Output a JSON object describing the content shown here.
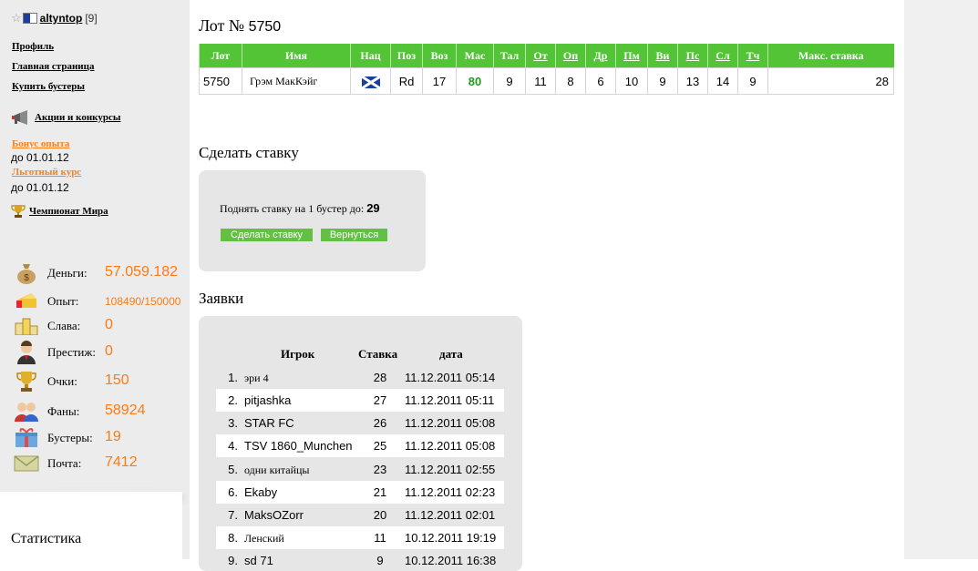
{
  "user": {
    "name": "altyntop",
    "level": "[9]"
  },
  "nav": {
    "profile": "Профиль",
    "home": "Главная страница",
    "buy_boosters": "Купить бустеры",
    "promos": "Акции и конкурсы",
    "bonus_label": "Бонус опыта",
    "bonus_until": "до 01.01.12",
    "course_label": "Льготный курс",
    "course_until": "до 01.01.12",
    "world_cup": "Чемпионат Мира"
  },
  "stats": [
    {
      "label": "Деньги:",
      "value": "57.059.182",
      "icon": "money-bag-icon"
    },
    {
      "label": "Опыт:",
      "value": "108490/150000",
      "icon": "cheese-icon"
    },
    {
      "label": "Слава:",
      "value": "0",
      "icon": "podium-icon"
    },
    {
      "label": "Престиж:",
      "value": "0",
      "icon": "person-icon"
    },
    {
      "label": "Очки:",
      "value": "150",
      "icon": "trophy-icon"
    },
    {
      "label": "Фаны:",
      "value": "58924",
      "icon": "fans-icon"
    },
    {
      "label": "Бустеры:",
      "value": "19",
      "icon": "gift-icon"
    },
    {
      "label": "Почта:",
      "value": "7412",
      "icon": "envelope-icon"
    }
  ],
  "stats_title": "Статистика",
  "lot": {
    "title_prefix": "Лот №",
    "number": "5750",
    "headers": [
      "Лот",
      "Имя",
      "Нац",
      "Поз",
      "Воз",
      "Мас",
      "Тал",
      "От",
      "Оп",
      "Др",
      "Пм",
      "Ви",
      "Пс",
      "Сл",
      "Тч",
      "Макс. ставка"
    ],
    "row": {
      "lot": "5750",
      "name": "Грэм МакКэйг",
      "nation": "Scotland",
      "pos": "Rd",
      "age": "17",
      "mas": "80",
      "tal": "9",
      "ot": "11",
      "op": "8",
      "dr": "6",
      "pm": "10",
      "vi": "9",
      "ps": "13",
      "sl": "14",
      "tch": "9",
      "max_bid": "28"
    }
  },
  "bid": {
    "title": "Сделать ставку",
    "text": "Поднять ставку на 1 бустер до:",
    "amount": "29",
    "submit": "Сделать ставку",
    "back": "Вернуться"
  },
  "requests": {
    "title": "Заявки",
    "headers": {
      "player": "Игрок",
      "bid": "Ставка",
      "date": "дата"
    },
    "rows": [
      {
        "n": "1.",
        "player": "эри 4",
        "bid": "28",
        "date": "11.12.2011 05:14"
      },
      {
        "n": "2.",
        "player": "pitjashka",
        "bid": "27",
        "date": "11.12.2011 05:11"
      },
      {
        "n": "3.",
        "player": "STAR FC",
        "bid": "26",
        "date": "11.12.2011 05:08"
      },
      {
        "n": "4.",
        "player": "TSV 1860_Munchen",
        "bid": "25",
        "date": "11.12.2011 05:08"
      },
      {
        "n": "5.",
        "player": "одни китайцы",
        "bid": "23",
        "date": "11.12.2011 02:55"
      },
      {
        "n": "6.",
        "player": "Ekaby",
        "bid": "21",
        "date": "11.12.2011 02:23"
      },
      {
        "n": "7.",
        "player": "MaksOZorr",
        "bid": "20",
        "date": "11.12.2011 02:01"
      },
      {
        "n": "8.",
        "player": "Ленский",
        "bid": "11",
        "date": "10.12.2011 19:19"
      },
      {
        "n": "9.",
        "player": "sd 71",
        "bid": "9",
        "date": "10.12.2011 16:38"
      }
    ]
  },
  "colors": {
    "accent_orange": "#ff7a10",
    "header_green": "#52c435",
    "button_green": "#62c142"
  }
}
